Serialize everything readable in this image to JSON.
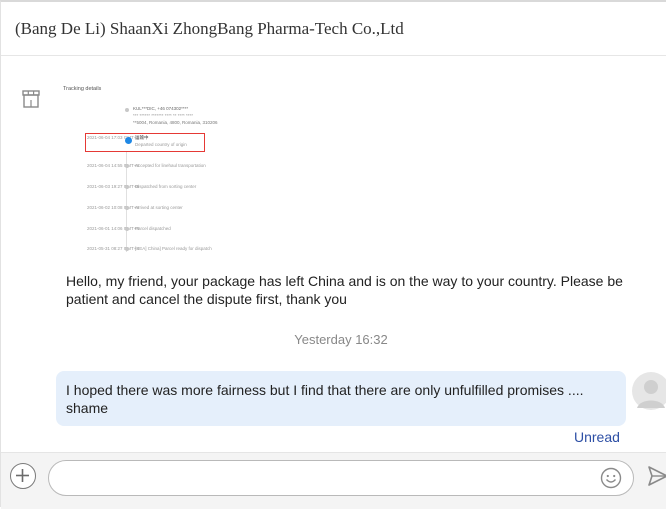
{
  "header": {
    "title": "(Bang De Li) ShaanXi ZhongBang Pharma-Tech Co.,Ltd"
  },
  "tracking_image": {
    "title": "Tracking details",
    "address_line_1": "KUL***DIC, +46 074302****",
    "address_line_2": "*** ****** ******* **** ** **** ****",
    "address_line_3": "**5004, Romania, 4800, Romania, 310206",
    "events": [
      {
        "time": "2021-06-04 17:03 GMT+8",
        "status": "运输中",
        "detail": "Departed country of origin"
      },
      {
        "time": "2021-06-04 14:55 GMT+8",
        "status": "Accepted for linehaul transportation"
      },
      {
        "time": "2021-06-03 19:27 GMT+8",
        "status": "Dispatched from sorting center"
      },
      {
        "time": "2021-06-02 10:08 GMT+8",
        "status": "Arrived at sorting center"
      },
      {
        "time": "2021-06-01 14:06 GMT+8",
        "status": "Parcel dispatched"
      },
      {
        "time": "2021-05-31 08:27 GMT+8",
        "status": "[SEA] China] Parcel ready for dispatch"
      }
    ]
  },
  "messages": {
    "seller_message": "Hello, my friend, your package has left China and is on the way to your country. Please be patient and cancel the dispute first, thank you",
    "timestamp": "Yesterday 16:32",
    "buyer_message": "I hoped there was more fairness but I find that there are only unfulfilled promises .... shame",
    "read_status": "Unread"
  },
  "composer": {
    "input_value": "",
    "placeholder": ""
  },
  "icons": {
    "add": "plus-icon",
    "emoji": "smiley-icon",
    "send": "send-icon",
    "store": "store-icon",
    "user": "user-avatar-icon"
  },
  "colors": {
    "buyer_bubble": "#e5effb",
    "unread_link": "#2d4fa5",
    "highlight_box": "#e53935"
  }
}
